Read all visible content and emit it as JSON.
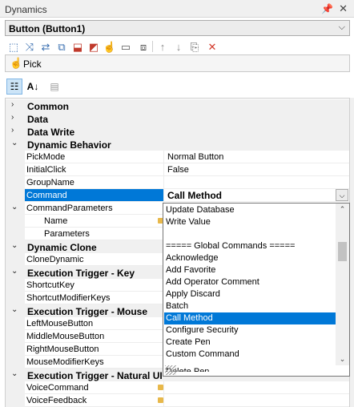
{
  "panel": {
    "title": "Dynamics",
    "pin_glyph": "📌",
    "close_glyph": "✕"
  },
  "selector": {
    "value": "Button (Button1)",
    "arrow": "⌵"
  },
  "toolbar": {
    "icons": [
      {
        "name": "select-icon",
        "glyph": "⬚",
        "color": "#3a6fb0"
      },
      {
        "name": "connect-icon",
        "glyph": "⤨",
        "color": "#3a6fb0"
      },
      {
        "name": "flow-icon",
        "glyph": "⇄",
        "color": "#3a6fb0"
      },
      {
        "name": "link-icon",
        "glyph": "⧉",
        "color": "#3a6fb0"
      },
      {
        "name": "move-icon",
        "glyph": "⬓",
        "color": "#c0392b"
      },
      {
        "name": "shape-icon",
        "glyph": "◩",
        "color": "#c0392b"
      },
      {
        "name": "pick-action-icon",
        "glyph": "☝",
        "color": "#c0392b"
      },
      {
        "name": "value-icon",
        "glyph": "▭",
        "color": "#555555"
      },
      {
        "name": "group-icon",
        "glyph": "⧈",
        "color": "#555555"
      },
      {
        "name": "arrow-up-icon",
        "glyph": "↑",
        "color": "#8a8a8a"
      },
      {
        "name": "arrow-down-icon",
        "glyph": "↓",
        "color": "#8a8a8a"
      },
      {
        "name": "copy-icon",
        "glyph": "⎘",
        "color": "#555555"
      },
      {
        "name": "delete-icon",
        "glyph": "✕",
        "color": "#d33a2c"
      }
    ]
  },
  "pick": {
    "label": "Pick",
    "icon": "☝"
  },
  "property_toolbar": {
    "categorized_glyph": "☷",
    "alpha_glyph": "A↓",
    "pages_glyph": "▤"
  },
  "grid": {
    "rows": [
      {
        "type": "cat",
        "name": "Common",
        "exp": "›"
      },
      {
        "type": "cat",
        "name": "Data",
        "exp": "›"
      },
      {
        "type": "cat",
        "name": "Data Write",
        "exp": "›"
      },
      {
        "type": "cat",
        "name": "Dynamic Behavior",
        "exp": "⌄"
      },
      {
        "type": "prop",
        "name": "PickMode",
        "value": "Normal Button"
      },
      {
        "type": "prop",
        "name": "InitialClick",
        "value": "False"
      },
      {
        "type": "prop",
        "name": "GroupName",
        "value": ""
      },
      {
        "type": "prop",
        "name": "Command",
        "value": "Call Method",
        "selected": true
      },
      {
        "type": "prop",
        "name": "CommandParameters",
        "value": "",
        "exp": "⌄"
      },
      {
        "type": "sub",
        "name": "Name",
        "value": "",
        "icon": true
      },
      {
        "type": "sub",
        "name": "Parameters",
        "value": ""
      },
      {
        "type": "cat",
        "name": "Dynamic Clone",
        "exp": "⌄"
      },
      {
        "type": "prop",
        "name": "CloneDynamic",
        "value": ""
      },
      {
        "type": "cat",
        "name": "Execution Trigger - Key",
        "exp": "⌄"
      },
      {
        "type": "prop",
        "name": "ShortcutKey",
        "value": ""
      },
      {
        "type": "prop",
        "name": "ShortcutModifierKeys",
        "value": ""
      },
      {
        "type": "cat",
        "name": "Execution Trigger - Mouse",
        "exp": "⌄"
      },
      {
        "type": "prop",
        "name": "LeftMouseButton",
        "value": ""
      },
      {
        "type": "prop",
        "name": "MiddleMouseButton",
        "value": ""
      },
      {
        "type": "prop",
        "name": "RightMouseButton",
        "value": ""
      },
      {
        "type": "prop",
        "name": "MouseModifierKeys",
        "value": ""
      },
      {
        "type": "cat",
        "name": "Execution Trigger - Natural UI",
        "exp": "⌄"
      },
      {
        "type": "prop",
        "name": "VoiceCommand",
        "value": "",
        "icon": true
      },
      {
        "type": "prop",
        "name": "VoiceFeedback",
        "value": "",
        "icon": true
      }
    ]
  },
  "dropdown": {
    "items": [
      "Update Database",
      "Write Value",
      "",
      "===== Global Commands =====",
      "Acknowledge",
      "Add Favorite",
      "Add Operator Comment",
      "Apply Discard",
      "Batch",
      "Call Method",
      "Configure Security",
      "Create Pen",
      "Custom Command"
    ],
    "highlighted": "Call Method",
    "cut_item": "Delete Pen",
    "scroll_up": "⌃",
    "scroll_down": "⌄",
    "combo_arrow": "⌵"
  }
}
